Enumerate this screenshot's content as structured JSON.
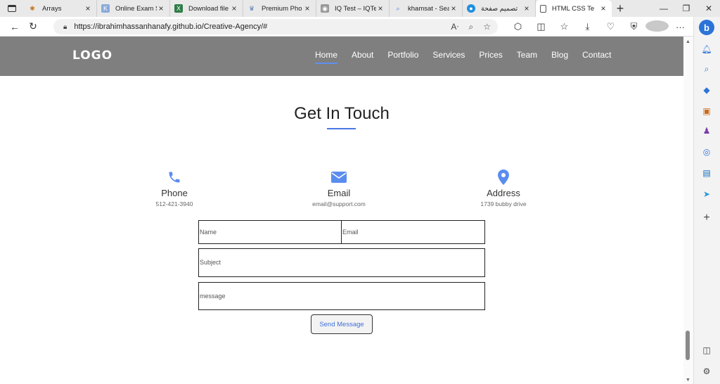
{
  "browser": {
    "tabs": [
      {
        "title": "Arrays",
        "icon": "arrays-tab-icon",
        "active": false
      },
      {
        "title": "Online Exam S",
        "icon": "exam-tab-icon",
        "active": false
      },
      {
        "title": "Download file",
        "icon": "excel-tab-icon",
        "active": false
      },
      {
        "title": "Premium Pho",
        "icon": "premium-tab-icon",
        "active": false
      },
      {
        "title": "IQ Test – IQTe",
        "icon": "iqtest-tab-icon",
        "active": false
      },
      {
        "title": "khamsat - Sea",
        "icon": "search-tab-icon",
        "active": false
      },
      {
        "title": "تصميم صفحة",
        "icon": "design-tab-icon",
        "active": false
      },
      {
        "title": "HTML CSS Te",
        "icon": "page-tab-icon",
        "active": true
      }
    ],
    "url": "https://ibrahimhassanhanafy.github.io/Creative-Agency/#"
  },
  "site": {
    "logo": "LOGO",
    "nav": [
      "Home",
      "About",
      "Portfolio",
      "Services",
      "Prices",
      "Team",
      "Blog",
      "Contact"
    ],
    "active_nav": "Home"
  },
  "contact": {
    "title": "Get In Touch",
    "info": [
      {
        "label": "Phone",
        "value": "512-421-3940",
        "icon": "phone-icon"
      },
      {
        "label": "Email",
        "value": "email@support.com",
        "icon": "envelope-icon"
      },
      {
        "label": "Address",
        "value": "1739 bubby drive",
        "icon": "map-pin-icon"
      }
    ],
    "form": {
      "name_placeholder": "Name",
      "email_placeholder": "Email",
      "subject_placeholder": "Subject",
      "message_placeholder": "message",
      "submit_label": "Send Message"
    }
  },
  "colors": {
    "header_bg": "#7f7f7f",
    "accent": "#4a78e4",
    "icon_blue": "#5b8def"
  }
}
